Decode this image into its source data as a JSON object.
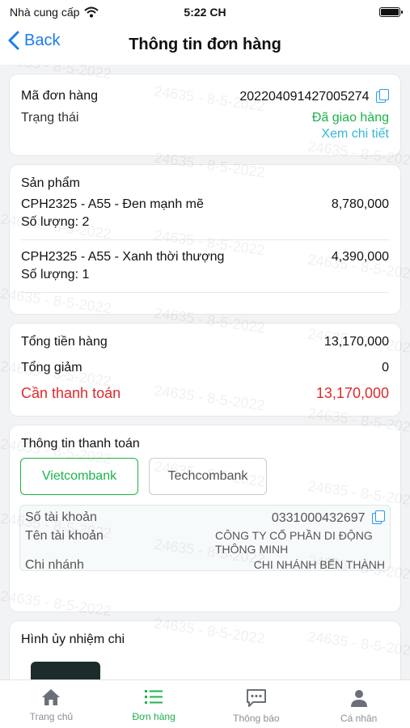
{
  "status_bar": {
    "carrier": "Nhà cung cấp",
    "time": "5:22 CH"
  },
  "nav": {
    "back_label": "Back",
    "title": "Thông tin đơn hàng"
  },
  "order": {
    "code_label": "Mã đơn hàng",
    "code": "202204091427005274",
    "status_label": "Trạng thái",
    "status": "Đã giao hàng",
    "detail_link": "Xem chi tiết"
  },
  "products": {
    "header": "Sản phẩm",
    "items": [
      {
        "name": "CPH2325 - A55 - Đen mạnh mẽ",
        "qty": "Số lượng: 2",
        "price": "8,780,000"
      },
      {
        "name": "CPH2325 - A55 - Xanh thời thượng",
        "qty": "Số lượng: 1",
        "price": "4,390,000"
      }
    ]
  },
  "totals": {
    "subtotal_label": "Tổng tiền hàng",
    "subtotal": "13,170,000",
    "discount_label": "Tổng giảm",
    "discount": "0",
    "due_label": "Cần thanh toán",
    "due": "13,170,000"
  },
  "payment": {
    "header": "Thông tin thanh toán",
    "banks": [
      "Vietcombank",
      "Techcombank"
    ],
    "selected_bank": "Vietcombank",
    "account_no_label": "Số tài khoản",
    "account_no": "0331000432697",
    "account_name_label": "Tên tài khoản",
    "account_name_line1": "CÔNG TY CỔ PHẦN DI ĐỘNG",
    "account_name_line2": "THÔNG MINH",
    "branch_label": "Chi nhánh",
    "branch": "CHI NHÁNH BẾN THÀNH"
  },
  "proof": {
    "header": "Hình ủy nhiệm chi"
  },
  "watermark": "24635 - 8-5-2022",
  "tabs": [
    {
      "label": "Trang chủ",
      "icon": "home-icon"
    },
    {
      "label": "Đơn hàng",
      "icon": "list-icon"
    },
    {
      "label": "Thông báo",
      "icon": "chat-icon"
    },
    {
      "label": "Cá nhân",
      "icon": "person-icon"
    }
  ],
  "colors": {
    "accent_green": "#1bb34a",
    "link_blue": "#1a7cf0",
    "alert_red": "#e12a2a",
    "cyan": "#34b8d6"
  }
}
